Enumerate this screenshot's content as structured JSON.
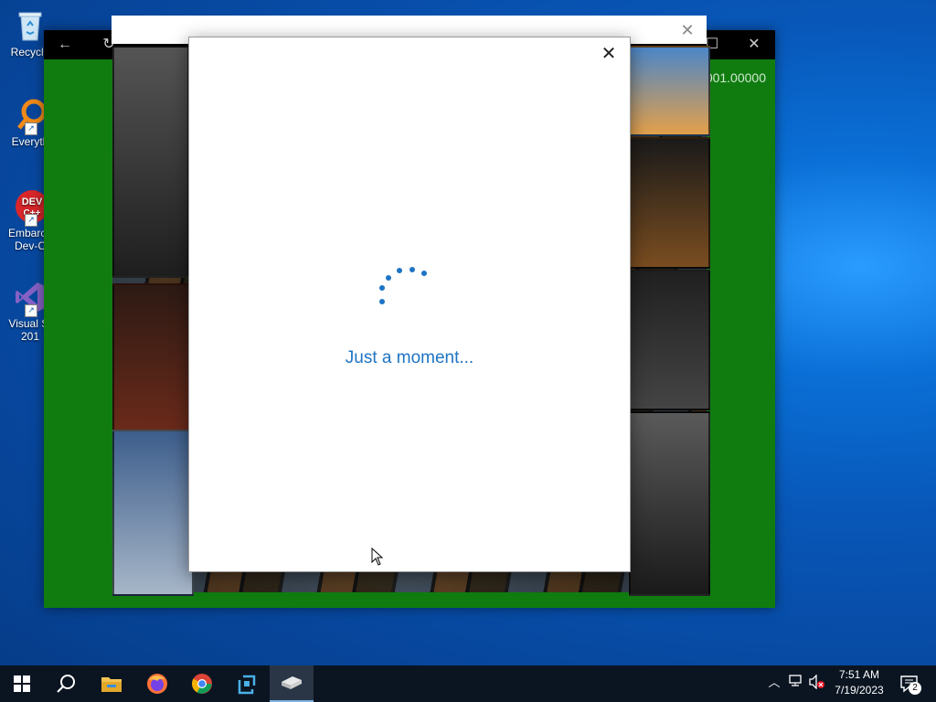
{
  "desktop": {
    "icons": [
      {
        "label": "Recycle",
        "label2": "",
        "icon": "recycle-bin-icon"
      },
      {
        "label": "Everyth",
        "label2": "",
        "icon": "everything-search-icon"
      },
      {
        "label": "Embarca",
        "label2": "Dev-C",
        "icon": "devcpp-icon"
      },
      {
        "label": "Visual St",
        "label2": "201",
        "icon": "visual-studio-icon"
      }
    ]
  },
  "xbox_window": {
    "version_text": "001.00000"
  },
  "dialog": {
    "loading_text": "Just a moment..."
  },
  "taskbar": {
    "time": "7:51 AM",
    "date": "7/19/2023",
    "notification_count": "2",
    "pinned": [
      "start-icon",
      "search-icon",
      "file-explorer-icon",
      "firefox-icon",
      "chrome-icon",
      "app-icon",
      "xbox-app-icon"
    ]
  },
  "colors": {
    "accent": "#1e74c4",
    "xbox_green": "#107c10",
    "taskbar": "#0b1522"
  }
}
